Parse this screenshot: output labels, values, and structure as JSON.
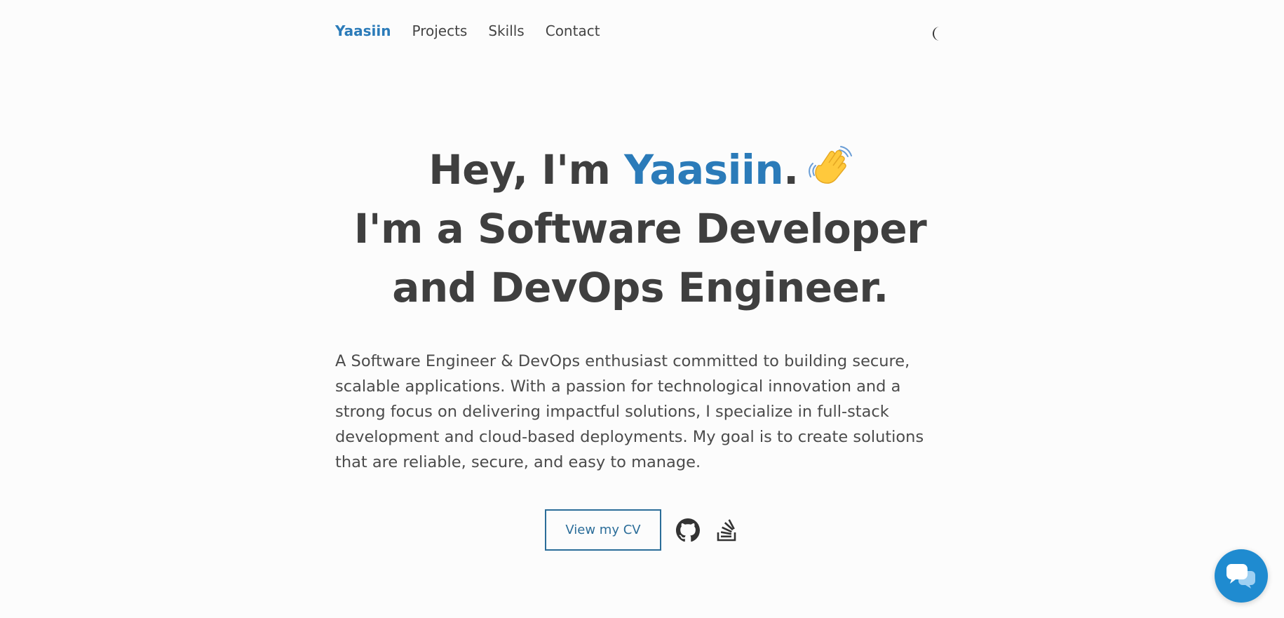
{
  "nav": {
    "brand": "Yaasiin",
    "links": [
      "Projects",
      "Skills",
      "Contact"
    ]
  },
  "hero": {
    "greeting_prefix": "Hey, I'm ",
    "name": "Yaasiin",
    "greeting_suffix": ".",
    "line2": "I'm a Software Developer",
    "line3": "and DevOps Engineer."
  },
  "intro": "A Software Engineer & DevOps enthusiast committed to building secure, scalable applications. With a passion for technological innovation and a strong focus on delivering impactful solutions, I specialize in full-stack development and cloud-based deployments. My goal is to create solutions that are reliable, secure, and easy to manage.",
  "actions": {
    "cv_label": "View my CV"
  },
  "icons": {
    "theme": "moon-icon",
    "wave": "waving-hand-icon",
    "github": "github-icon",
    "stackoverflow": "stackoverflow-icon",
    "chat": "chat-icon"
  },
  "colors": {
    "accent": "#2b7bb9",
    "text": "#444444",
    "background": "#fcfcfc",
    "chat_button": "#1f8bd0"
  }
}
